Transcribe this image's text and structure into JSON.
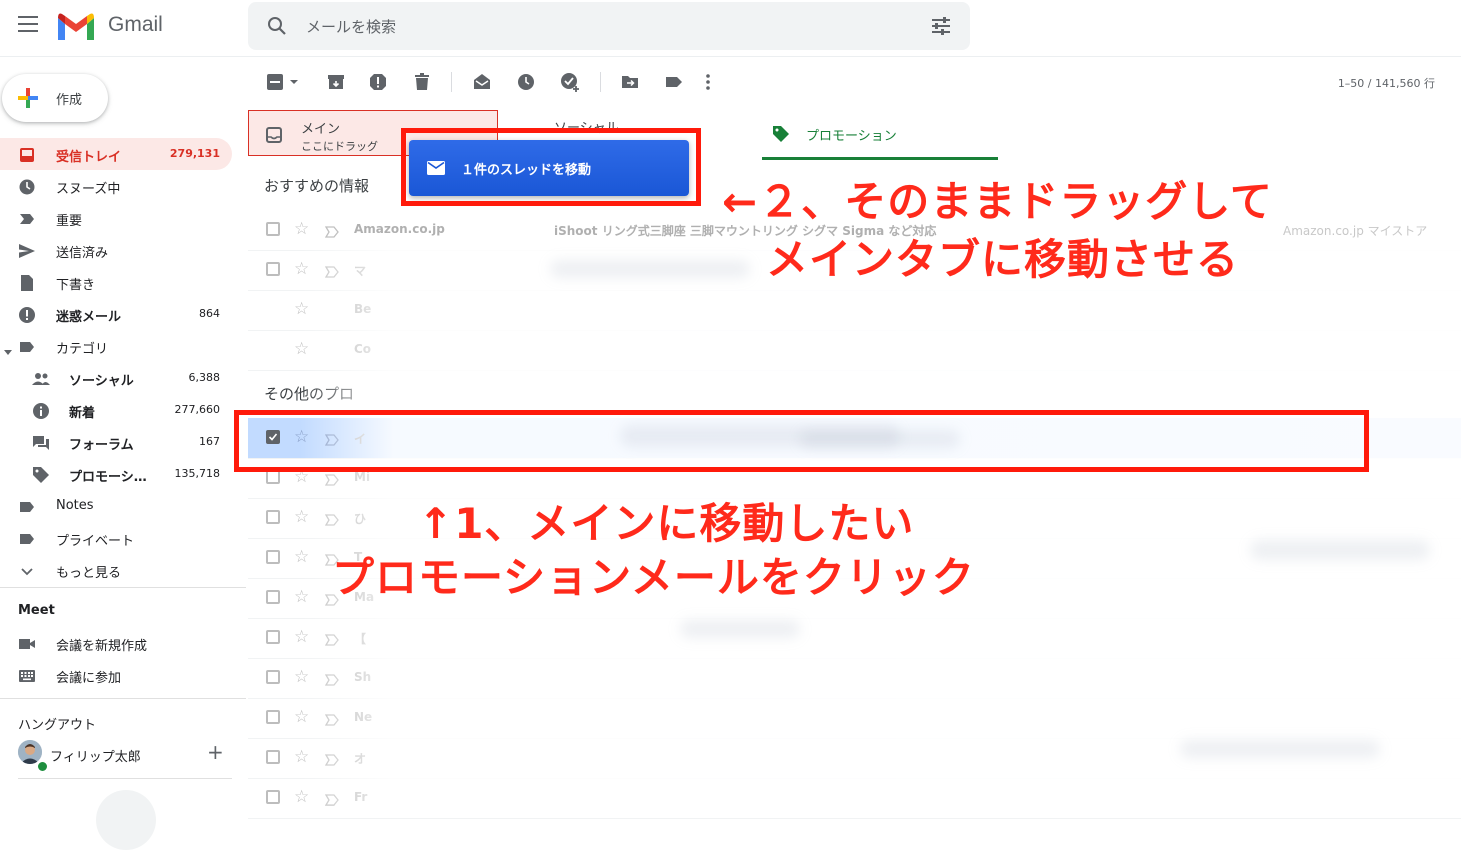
{
  "app": {
    "name": "Gmail"
  },
  "search": {
    "placeholder": "メールを検索"
  },
  "compose": {
    "label": "作成"
  },
  "sidebar": {
    "items": [
      {
        "label": "受信トレイ",
        "count": "279,131"
      },
      {
        "label": "スヌーズ中",
        "count": ""
      },
      {
        "label": "重要",
        "count": ""
      },
      {
        "label": "送信済み",
        "count": ""
      },
      {
        "label": "下書き",
        "count": ""
      },
      {
        "label": "迷惑メール",
        "count": "864"
      },
      {
        "label": "カテゴリ",
        "count": ""
      },
      {
        "label": "ソーシャル",
        "count": "6,388"
      },
      {
        "label": "新着",
        "count": "277,660"
      },
      {
        "label": "フォーラム",
        "count": "167"
      },
      {
        "label": "プロモーシ…",
        "count": "135,718"
      },
      {
        "label": "Notes",
        "count": ""
      },
      {
        "label": "プライベート",
        "count": ""
      },
      {
        "label": "もっと見る",
        "count": ""
      }
    ],
    "meet": {
      "title": "Meet",
      "new_meeting": "会議を新規作成",
      "join": "会議に参加"
    },
    "hangouts": {
      "title": "ハングアウト",
      "user": "フィリップ太郎",
      "add": "+"
    }
  },
  "toolbar": {
    "page_range": "1–50 / 141,560 行"
  },
  "tabs": {
    "main": {
      "label": "メイン",
      "hint": "ここにドラッグ"
    },
    "social": {
      "label": "ソーシャル"
    },
    "promo": {
      "label": "プロモーション"
    }
  },
  "drag_chip": {
    "label": "１件のスレッドを移動"
  },
  "sections": {
    "recommended": "おすすめの情報",
    "others": "その他のプロ"
  },
  "rows": [
    {
      "sender": "Amazon.co.jp",
      "subject": "iShoot リング式三脚座 三脚マウントリング シグマ Sigma など対応",
      "snippet": "Amazon.co.jp マイストア"
    },
    {
      "sender": "マ",
      "subject": "",
      "snippet": ""
    },
    {
      "sender": "Be",
      "subject": "",
      "snippet": ""
    },
    {
      "sender": "Co",
      "subject": "",
      "snippet": ""
    },
    {
      "sender": "イ",
      "subject": "",
      "snippet": ""
    },
    {
      "sender": "Mi",
      "subject": "",
      "snippet": ""
    },
    {
      "sender": "ひ",
      "subject": "",
      "snippet": ""
    },
    {
      "sender": "T",
      "subject": "",
      "snippet": ""
    },
    {
      "sender": "Ma",
      "subject": "",
      "snippet": ""
    },
    {
      "sender": "【",
      "subject": "",
      "snippet": ""
    },
    {
      "sender": "Sh",
      "subject": "",
      "snippet": ""
    },
    {
      "sender": "Ne",
      "subject": "",
      "snippet": ""
    },
    {
      "sender": "オ",
      "subject": "",
      "snippet": ""
    },
    {
      "sender": "Fr",
      "subject": "",
      "snippet": ""
    }
  ],
  "annotations": {
    "step2_line1": "←２、そのままドラッグして",
    "step2_line2": "メインタブに移動させる",
    "step1_line1": "↑1、メインに移動したい",
    "step1_line2": "プロモーションメールをクリック"
  },
  "colors": {
    "accent_red": "#ff1a0b",
    "inbox_red": "#d93025",
    "promo_green": "#188038",
    "drag_blue": "#1a57d6",
    "selected_row": "#c2dbff"
  }
}
